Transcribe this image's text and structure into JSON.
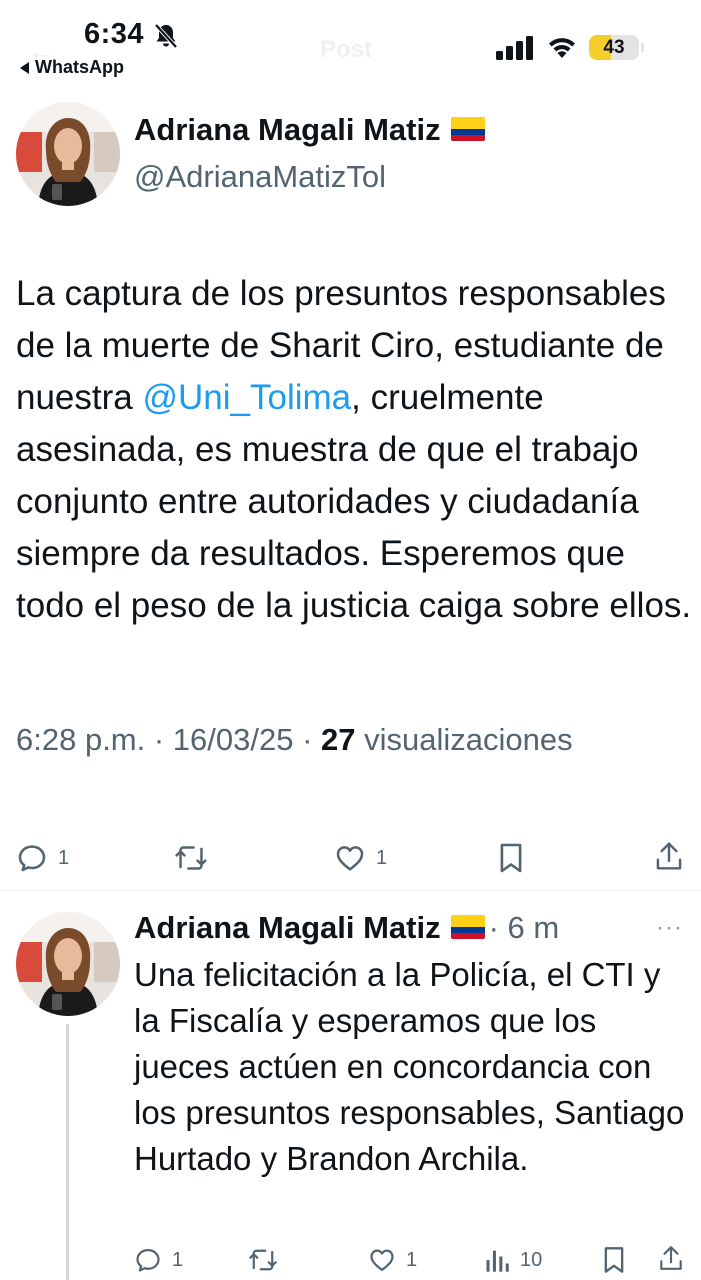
{
  "status_bar": {
    "time": "6:34",
    "back_app": "WhatsApp",
    "header_title": "Post",
    "battery": "43",
    "battery_level": 0.43
  },
  "tweet": {
    "author_name": "Adriana Magali Matiz",
    "handle": "@AdrianaMatizTol",
    "text_before": "La captura de los presuntos responsables de la muerte de Sharit Ciro, estudiante de nuestra ",
    "mention": "@Uni_Tolima",
    "text_after": ", cruelmente asesinada, es muestra de que el trabajo conjunto entre autoridades y ciudadanía siempre da resultados. Esperemos que todo el peso de la justicia caiga sobre ellos.",
    "meta_time": "6:28 p.m. · 16/03/25 · ",
    "views_count": "27",
    "views_label": " visualizaciones",
    "actions": {
      "replies": "1",
      "retweets": "",
      "likes": "1"
    }
  },
  "reply": {
    "author_name": "Adriana Magali Matiz",
    "time": "· 6 m",
    "more": "···",
    "text": "Una felicitación a la Policía, el CTI y la Fiscalía y esperamos que los jueces actúen en concordancia con los presuntos responsables, Santiago Hurtado y Brandon Archila.",
    "actions": {
      "replies": "1",
      "likes": "1",
      "views": "10"
    }
  },
  "colors": {
    "link": "#1d9bf0",
    "secondary_text": "#536471",
    "battery_fill": "#f5cd2d",
    "flag_yellow": "#fcd116",
    "flag_blue": "#003893",
    "flag_red": "#ce1126"
  },
  "icons": [
    "bell-off-icon",
    "signal-icon",
    "wifi-icon",
    "battery-icon",
    "flag-colombia-icon",
    "reply-icon",
    "retweet-icon",
    "like-icon",
    "bookmark-icon",
    "share-icon",
    "views-icon",
    "more-icon"
  ]
}
